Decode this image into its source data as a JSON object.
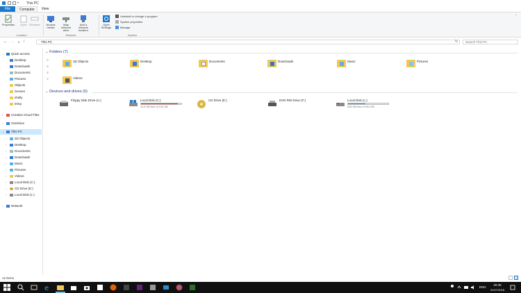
{
  "window": {
    "title": "This PC"
  },
  "ribbon": {
    "tabs": [
      "File",
      "Computer",
      "View"
    ],
    "buttons": {
      "properties": "Properties",
      "open": "Open",
      "rename": "Rename",
      "access_media": "Access media",
      "map_network_drive": "Map network drive",
      "add_network_location": "Add a network location",
      "open_settings": "Open Settings"
    },
    "system_items": [
      "Uninstall or change a program",
      "System properties",
      "Manage"
    ],
    "groups": {
      "location": "Location",
      "network": "Network",
      "system": "System"
    }
  },
  "address": {
    "path": "This PC",
    "search_placeholder": "Search This PC"
  },
  "nav": {
    "quick_access": "Quick access",
    "quick_items": [
      "Desktop",
      "Downloads",
      "Documents",
      "Pictures",
      "Objects",
      "Scenes",
      "shelly",
      "temp"
    ],
    "creative_cloud": "Creative Cloud Files",
    "onedrive": "OneDrive",
    "this_pc": "This PC",
    "pc_items": [
      "3D Objects",
      "Desktop",
      "Documents",
      "Downloads",
      "Music",
      "Pictures",
      "Videos",
      "Local Disk (C:)",
      "CD Drive (E:)",
      "Local Disk (L:)"
    ],
    "network": "Network"
  },
  "content": {
    "folders_header": "Folders (7)",
    "folders": [
      "3D Objects",
      "Desktop",
      "Documents",
      "Downloads",
      "Music",
      "Pictures",
      "Videos"
    ],
    "devices_header": "Devices and drives (5)",
    "drives": [
      {
        "name": "Floppy Disk Drive (A:)",
        "free": ""
      },
      {
        "name": "Local Disk (C:)",
        "free": "12.5 GB free of 133 GB",
        "used_fraction": 0.91,
        "bar_color": "#da2626"
      },
      {
        "name": "CD Drive (E:)",
        "free": ""
      },
      {
        "name": "DVD RW Drive (F:)",
        "free": ""
      },
      {
        "name": "Local Disk (L:)",
        "free": "528 GB free of 931 GB",
        "used_fraction": 0.43,
        "bar_color": "#26a0da"
      }
    ]
  },
  "status": {
    "items": "12 items"
  },
  "taskbar": {
    "lang": "ENG",
    "time": "20:36",
    "date": "01/07/2018"
  },
  "colors": {
    "accent": "#1979ca",
    "selected": "#cce8ff",
    "section": "#1e3287",
    "taskbar": "#101010"
  }
}
